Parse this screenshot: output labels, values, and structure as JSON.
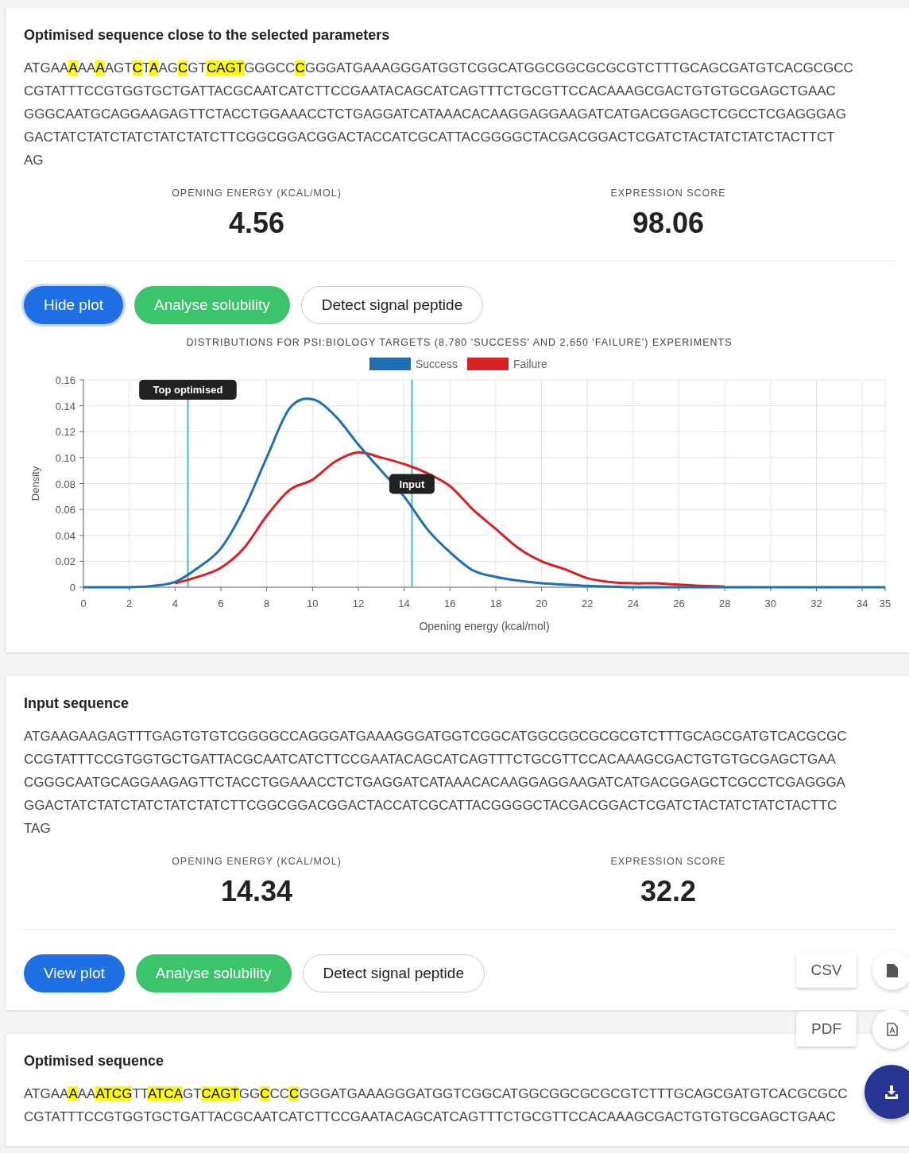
{
  "sections": [
    {
      "title": "Optimised sequence close to the selected parameters",
      "lines": [
        [
          {
            "text": "ATGAA",
            "highlighted": false
          },
          {
            "text": "A",
            "highlighted": true
          },
          {
            "text": "AA",
            "highlighted": false
          },
          {
            "text": "A",
            "highlighted": true
          },
          {
            "text": "AGT",
            "highlighted": false
          },
          {
            "text": "C",
            "highlighted": true
          },
          {
            "text": "T",
            "highlighted": false
          },
          {
            "text": "A",
            "highlighted": true
          },
          {
            "text": "AG",
            "highlighted": false
          },
          {
            "text": "C",
            "highlighted": true
          },
          {
            "text": "GT",
            "highlighted": false
          },
          {
            "text": "CAGT",
            "highlighted": true
          },
          {
            "text": "GGGCC",
            "highlighted": false
          },
          {
            "text": "C",
            "highlighted": true
          },
          {
            "text": "GGGATGAAAGGGATGGTCGGCATGGCGGCGCGCGTCTTTGCAGCGATGTCACGCGCC",
            "highlighted": false
          }
        ],
        [
          {
            "text": "CGTATTTCCGTGGTGCTGATTACGCAATCATCTTCCGAATACAGCATCAGTTTCTGCGTTCCACAAAGCGACTGTGTGCGAGCTGAAC",
            "highlighted": false
          }
        ],
        [
          {
            "text": "GGGCAATGCAGGAAGAGTTCTACCTGGAAACCTCTGAGGATCATAAACACAAGGAGGAAGATCATGACGGAGCTCGCCTCGAGGGAG",
            "highlighted": false
          }
        ],
        [
          {
            "text": "GACTATCTATCTATCTATCTATCTTCGGCGGACGGACTACCATCGCATTACGGGGCTACGACGGACTCGATCTACTATCTATCTACTTCT",
            "highlighted": false
          }
        ],
        [
          {
            "text": "AG",
            "highlighted": false
          }
        ]
      ],
      "metrics": [
        {
          "label": "OPENING ENERGY (KCAL/MOL)",
          "value": "4.56"
        },
        {
          "label": "EXPRESSION SCORE",
          "value": "98.06"
        }
      ],
      "buttons": [
        {
          "label": "Hide plot",
          "kind": "primary",
          "focused": true
        },
        {
          "label": "Analyse solubility",
          "kind": "success",
          "focused": false
        },
        {
          "label": "Detect signal peptide",
          "kind": "outline",
          "focused": false
        }
      ],
      "plot": {
        "chart_data": {
          "type": "line",
          "title": "DISTRIBUTIONS FOR PSI:BIOLOGY TARGETS (8,780 'SUCCESS' AND 2,650 'FAILURE') EXPERIMENTS",
          "xlabel": "Opening energy (kcal/mol)",
          "ylabel": "Density",
          "x": [
            0,
            1,
            2,
            3,
            4,
            5,
            6,
            7,
            8,
            9,
            10,
            11,
            12,
            13,
            14,
            15,
            16,
            17,
            18,
            19,
            20,
            21,
            22,
            23,
            24,
            25,
            26,
            27,
            28,
            29,
            30,
            31,
            32,
            33,
            34,
            35
          ],
          "series": [
            {
              "name": "Success",
              "color": "#1f6fb4",
              "values": [
                0,
                0,
                0,
                0.001,
                0.004,
                0.015,
                0.03,
                0.06,
                0.1,
                0.138,
                0.145,
                0.132,
                0.11,
                0.09,
                0.07,
                0.045,
                0.027,
                0.013,
                0.008,
                0.005,
                0.003,
                0.002,
                0.001,
                0.0005,
                0,
                0,
                0,
                0,
                0,
                0,
                0,
                0,
                0,
                0,
                0,
                0
              ]
            },
            {
              "name": "Failure",
              "color": "#d62226",
              "values": [
                null,
                null,
                null,
                null,
                0.003,
                0.008,
                0.015,
                0.03,
                0.055,
                0.075,
                0.083,
                0.097,
                0.104,
                0.1,
                0.095,
                0.088,
                0.078,
                0.06,
                0.045,
                0.03,
                0.02,
                0.014,
                0.007,
                0.004,
                0.003,
                0.003,
                0.002,
                0.001,
                0.0005,
                null,
                null,
                null,
                null,
                null,
                null,
                null
              ]
            }
          ],
          "grid": true,
          "legend": true,
          "xlim": [
            0,
            35
          ],
          "ylim": [
            0,
            0.16
          ],
          "xticks": [
            0,
            2,
            4,
            6,
            8,
            10,
            12,
            14,
            16,
            18,
            20,
            22,
            24,
            26,
            28,
            30,
            32,
            34,
            35
          ],
          "yticks": [
            {
              "value": 0,
              "label": "0"
            },
            {
              "value": 0.02,
              "label": "0.02"
            },
            {
              "value": 0.04,
              "label": "0.04"
            },
            {
              "value": 0.06,
              "label": "0.06"
            },
            {
              "value": 0.08,
              "label": "0.08"
            },
            {
              "value": 0.1,
              "label": "0.10"
            },
            {
              "value": 0.12,
              "label": "0.12"
            },
            {
              "value": 0.14,
              "label": "0.14"
            },
            {
              "value": 0.16,
              "label": "0.16"
            }
          ],
          "ref_lines": [
            {
              "axis": "x",
              "value": 4.56,
              "label": "Top optimised"
            },
            {
              "axis": "x",
              "value": 14.34,
              "label": "Input"
            }
          ]
        }
      }
    },
    {
      "title": "Input sequence",
      "lines": [
        [
          {
            "text": "ATGAAGAAGAGTTTGAGTGTGTCGGGGCCAGGGATGAAAGGGATGGTCGGCATGGCGGCGCGCGTCTTTGCAGCGATGTCACGCGC",
            "highlighted": false
          }
        ],
        [
          {
            "text": "CCGTATTTCCGTGGTGCTGATTACGCAATCATCTTCCGAATACAGCATCAGTTTCTGCGTTCCACAAAGCGACTGTGTGCGAGCTGAA",
            "highlighted": false
          }
        ],
        [
          {
            "text": "CGGGCAATGCAGGAAGAGTTCTACCTGGAAACCTCTGAGGATCATAAACACAAGGAGGAAGATCATGACGGAGCTCGCCTCGAGGGA",
            "highlighted": false
          }
        ],
        [
          {
            "text": "GGACTATCTATCTATCTATCTATCTTCGGCGGACGGACTACCATCGCATTACGGGGCTACGACGGACTCGATCTACTATCTATCTACTTC",
            "highlighted": false
          }
        ],
        [
          {
            "text": "TAG",
            "highlighted": false
          }
        ]
      ],
      "metrics": [
        {
          "label": "OPENING ENERGY (KCAL/MOL)",
          "value": "14.34"
        },
        {
          "label": "EXPRESSION SCORE",
          "value": "32.2"
        }
      ],
      "buttons": [
        {
          "label": "View plot",
          "kind": "primary",
          "focused": false
        },
        {
          "label": "Analyse solubility",
          "kind": "success",
          "focused": false
        },
        {
          "label": "Detect signal peptide",
          "kind": "outline",
          "focused": false
        }
      ]
    },
    {
      "title": "Optimised sequence",
      "lines": [
        [
          {
            "text": "ATGAA",
            "highlighted": false
          },
          {
            "text": "A",
            "highlighted": true
          },
          {
            "text": "AA",
            "highlighted": false
          },
          {
            "text": "ATCG",
            "highlighted": true
          },
          {
            "text": "TT",
            "highlighted": false
          },
          {
            "text": "ATCA",
            "highlighted": true
          },
          {
            "text": "GT",
            "highlighted": false
          },
          {
            "text": "CAGT",
            "highlighted": true
          },
          {
            "text": "GG",
            "highlighted": false
          },
          {
            "text": "C",
            "highlighted": true
          },
          {
            "text": "CC",
            "highlighted": false
          },
          {
            "text": "C",
            "highlighted": true
          },
          {
            "text": "GGGATGAAAGGGATGGTCGGCATGGCGGCGCGCGTCTTTGCAGCGATGTCACGCGCC",
            "highlighted": false
          }
        ],
        [
          {
            "text": "CGTATTTCCGTGGTGCTGATTACGCAATCATCTTCCGAATACAGCATCAGTTTCTGCGTTCCACAAAGCGACTGTGTGCGAGCTGAAC",
            "highlighted": false
          }
        ]
      ]
    }
  ],
  "export_menu": {
    "items": [
      {
        "label": "CSV"
      },
      {
        "label": "PDF"
      }
    ]
  }
}
